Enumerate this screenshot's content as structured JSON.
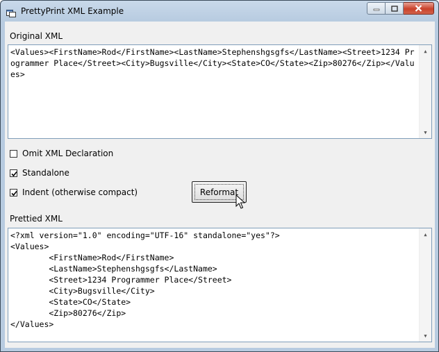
{
  "window": {
    "title": "PrettyPrint XML Example"
  },
  "icons": {
    "app": "app-window-icon",
    "minimize": "minimize-icon",
    "maximize": "maximize-icon",
    "close": "close-icon",
    "cursor": "mouse-pointer-icon"
  },
  "original": {
    "label": "Original XML",
    "value": "<Values><FirstName>Rod</FirstName><LastName>Stephenshgsgfs</LastName><Street>1234 Programmer Place</Street><City>Bugsville</City><State>CO</State><Zip>80276</Zip></Values>"
  },
  "options": {
    "omit_xml": {
      "label": "Omit XML Declaration",
      "checked": false
    },
    "standalone": {
      "label": "Standalone",
      "checked": true
    },
    "indent": {
      "label": "Indent (otherwise compact)",
      "checked": true
    }
  },
  "reformat_label": "Reformat",
  "prettied": {
    "label": "Prettied XML",
    "lines": [
      "<?xml version=\"1.0\" encoding=\"UTF-16\" standalone=\"yes\"?>",
      "<Values>",
      "        <FirstName>Rod</FirstName>",
      "        <LastName>Stephenshgsgfs</LastName>",
      "        <Street>1234 Programmer Place</Street>",
      "        <City>Bugsville</City>",
      "        <State>CO</State>",
      "        <Zip>80276</Zip>",
      "</Values>"
    ]
  }
}
